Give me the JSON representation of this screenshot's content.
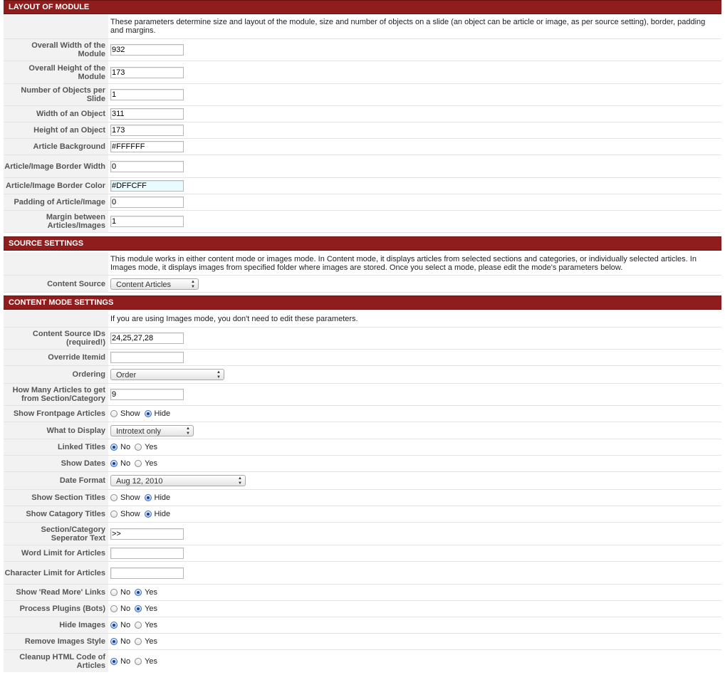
{
  "sections": {
    "layout": {
      "title": "LAYOUT OF MODULE",
      "description": "These parameters determine size and layout of the module, size and number of objects on a slide (an object can be article or image, as per source setting), border, padding and margins.",
      "fields": [
        {
          "label": "Overall Width of the Module",
          "value": "932"
        },
        {
          "label": "Overall Height of the Module",
          "value": "173"
        },
        {
          "label": "Number of Objects per Slide",
          "value": "1"
        },
        {
          "label": "Width of an Object",
          "value": "311"
        },
        {
          "label": "Height of an Object",
          "value": "173"
        },
        {
          "label": "Article Background",
          "value": "#FFFFFF"
        },
        {
          "label": "Article/Image Border Width",
          "value": "0"
        },
        {
          "label": "Article/Image Border Color",
          "value": "#DFFCFF"
        },
        {
          "label": "Padding of Article/Image",
          "value": "0"
        },
        {
          "label": "Margin between Articles/Images",
          "value": "1"
        }
      ]
    },
    "source": {
      "title": "SOURCE SETTINGS",
      "description": "This module works in either content mode or images mode. In Content mode, it displays articles from selected sections and categories, or individually selected articles. In Images mode, it displays images from specified folder where images are stored. Once you select a mode, please edit the mode's parameters below.",
      "content_source": {
        "label": "Content Source",
        "value": "Content Articles"
      }
    },
    "content_mode": {
      "title": "CONTENT MODE SETTINGS",
      "description": "If you are using Images mode, you don't need to edit these parameters.",
      "content_source_ids": {
        "label": "Content Source IDs (required!)",
        "value": "24,25,27,28"
      },
      "override_itemid": {
        "label": "Override Itemid",
        "value": ""
      },
      "ordering": {
        "label": "Ordering",
        "value": "Order"
      },
      "how_many": {
        "label": "How Many Articles to get from Section/Category",
        "value": "9"
      },
      "show_frontpage": {
        "label": "Show Frontpage Articles",
        "opt1": "Show",
        "opt2": "Hide"
      },
      "what_to_display": {
        "label": "What to Display",
        "value": "Introtext only"
      },
      "linked_titles": {
        "label": "Linked Titles",
        "opt1": "No",
        "opt2": "Yes"
      },
      "show_dates": {
        "label": "Show Dates",
        "opt1": "No",
        "opt2": "Yes"
      },
      "date_format": {
        "label": "Date Format",
        "value": "Aug 12, 2010"
      },
      "show_section_titles": {
        "label": "Show Section Titles",
        "opt1": "Show",
        "opt2": "Hide"
      },
      "show_category_titles": {
        "label": "Show Catagory Titles",
        "opt1": "Show",
        "opt2": "Hide"
      },
      "separator_text": {
        "label": "Section/Category Seperator Text",
        "value": ">>"
      },
      "word_limit": {
        "label": "Word Limit for Articles",
        "value": ""
      },
      "char_limit": {
        "label": "Character Limit for Articles",
        "value": ""
      },
      "show_read_more": {
        "label": "Show 'Read More' Links",
        "opt1": "No",
        "opt2": "Yes"
      },
      "process_plugins": {
        "label": "Process Plugins (Bots)",
        "opt1": "No",
        "opt2": "Yes"
      },
      "hide_images": {
        "label": "Hide Images",
        "opt1": "No",
        "opt2": "Yes"
      },
      "remove_images_style": {
        "label": "Remove Images Style",
        "opt1": "No",
        "opt2": "Yes"
      },
      "cleanup_html": {
        "label": "Cleanup HTML Code of Articles",
        "opt1": "No",
        "opt2": "Yes"
      }
    }
  },
  "colors": {
    "header_bg": "#8f1d1d",
    "label_bg": "#f2f2f2",
    "highlight_input": "#e9fbff"
  }
}
